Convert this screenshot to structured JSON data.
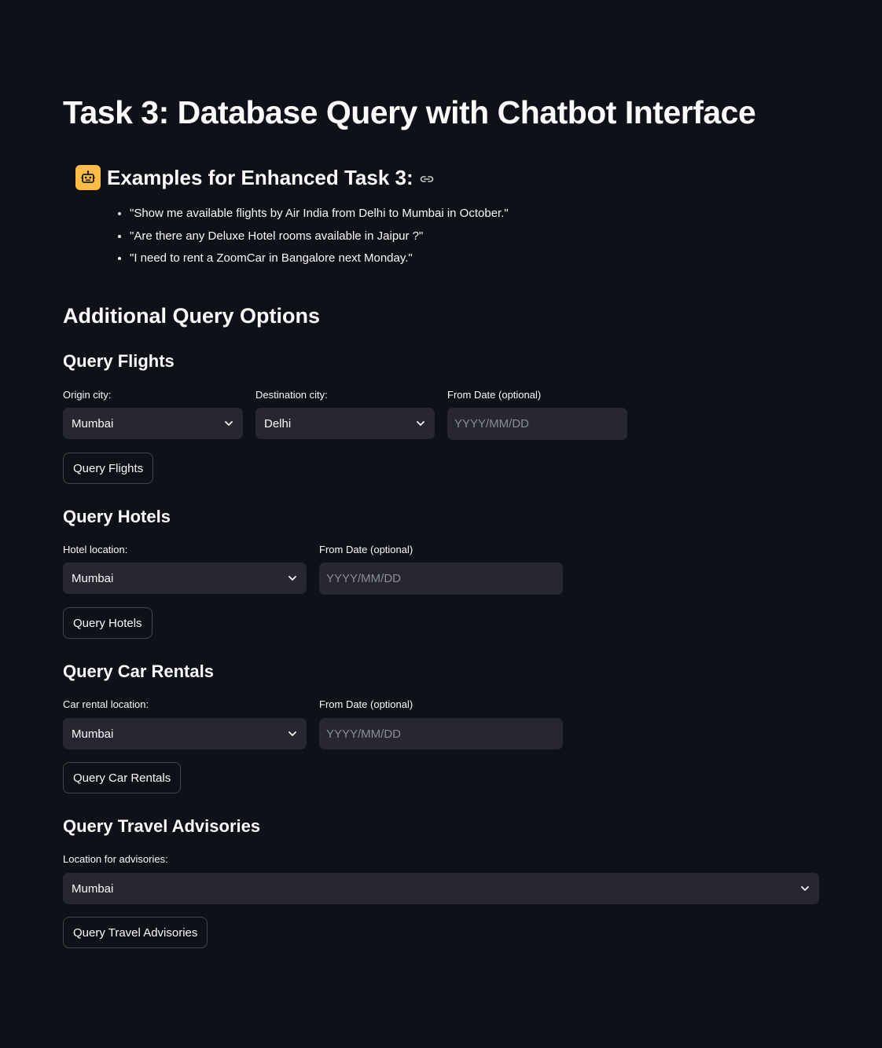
{
  "page_title": "Task 3: Database Query with Chatbot Interface",
  "examples": {
    "title": "Examples for Enhanced Task 3:",
    "icon": "robot-icon",
    "items": [
      "\"Show me available flights by Air India from Delhi to Mumbai in October.\"",
      "\"Are there any Deluxe Hotel rooms available in Jaipur ?\"",
      "\"I need to rent a ZoomCar in Bangalore next Monday.\""
    ]
  },
  "additional": {
    "title": "Additional Query Options"
  },
  "flights": {
    "title": "Query Flights",
    "origin_label": "Origin city:",
    "origin_value": "Mumbai",
    "destination_label": "Destination city:",
    "destination_value": "Delhi",
    "date_label": "From Date (optional)",
    "date_placeholder": "YYYY/MM/DD",
    "button": "Query Flights"
  },
  "hotels": {
    "title": "Query Hotels",
    "location_label": "Hotel location:",
    "location_value": "Mumbai",
    "date_label": "From Date (optional)",
    "date_placeholder": "YYYY/MM/DD",
    "button": "Query Hotels"
  },
  "cars": {
    "title": "Query Car Rentals",
    "location_label": "Car rental location:",
    "location_value": "Mumbai",
    "date_label": "From Date (optional)",
    "date_placeholder": "YYYY/MM/DD",
    "button": "Query Car Rentals"
  },
  "advisories": {
    "title": "Query Travel Advisories",
    "location_label": "Location for advisories:",
    "location_value": "Mumbai",
    "button": "Query Travel Advisories"
  },
  "colors": {
    "background": "#0e1117",
    "widget": "#262730",
    "accent_icon": "#ffbd45"
  }
}
